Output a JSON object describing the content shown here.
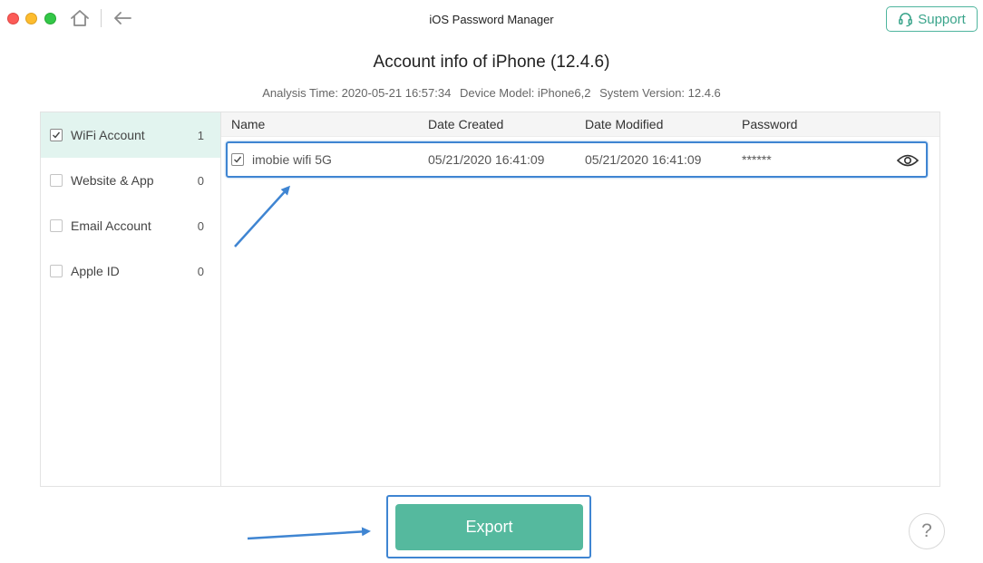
{
  "window": {
    "title": "iOS Password Manager",
    "support_label": "Support"
  },
  "header": {
    "title": "Account info of iPhone (12.4.6)",
    "analysis_time": "Analysis Time: 2020-05-21 16:57:34",
    "device_model": "Device Model: iPhone6,2",
    "system_version": "System Version: 12.4.6"
  },
  "sidebar": {
    "items": [
      {
        "label": "WiFi Account",
        "count": "1",
        "checked": true,
        "active": true
      },
      {
        "label": "Website & App",
        "count": "0",
        "checked": false,
        "active": false
      },
      {
        "label": "Email Account",
        "count": "0",
        "checked": false,
        "active": false
      },
      {
        "label": "Apple ID",
        "count": "0",
        "checked": false,
        "active": false
      }
    ]
  },
  "table": {
    "columns": [
      "Name",
      "Date Created",
      "Date Modified",
      "Password"
    ],
    "rows": [
      {
        "name": "imobie wifi 5G",
        "date_created": "05/21/2020 16:41:09",
        "date_modified": "05/21/2020 16:41:09",
        "password": "******",
        "checked": true
      }
    ]
  },
  "footer": {
    "export_label": "Export",
    "help_label": "?"
  },
  "colors": {
    "accent": "#55b99e",
    "highlight": "#3f85d2",
    "sidebar_active": "#e2f4ef"
  },
  "icons": [
    "home-icon",
    "back-arrow-icon",
    "headset-icon",
    "eye-icon",
    "checkbox-icon"
  ]
}
